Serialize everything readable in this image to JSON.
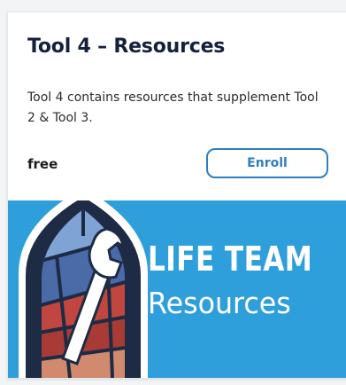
{
  "card": {
    "title": "Tool 4 – Resources",
    "description": "Tool 4 contains resources that supplement Tool 2 & Tool 3.",
    "price": "free",
    "enroll_label": "Enroll"
  },
  "banner": {
    "title": "LIFE TEAM",
    "subtitle": "Resources",
    "background_color": "#2f9fdb",
    "icon": "stained-glass-window-wrench-icon"
  },
  "colors": {
    "title": "#14213d",
    "accent": "#2f7fbd"
  }
}
